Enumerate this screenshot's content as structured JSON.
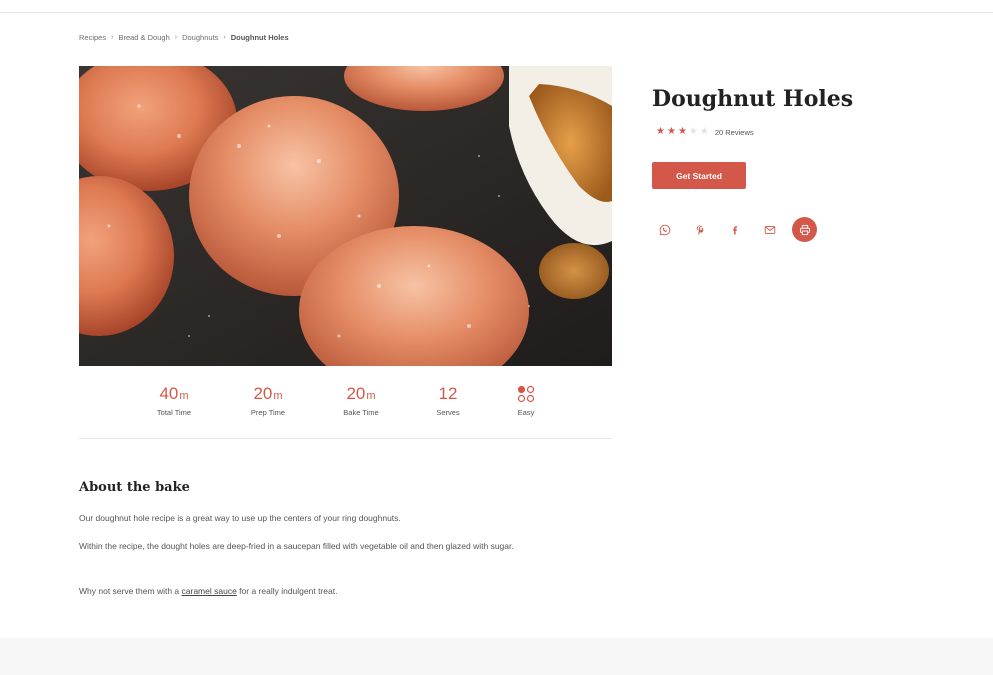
{
  "breadcrumb": {
    "items": [
      "Recipes",
      "Bread & Dough",
      "Doughnuts",
      "Doughnut Holes"
    ],
    "separator": "›"
  },
  "hero_image": {
    "alt": "Sugar coated doughnut holes with caramel sauce"
  },
  "stats": [
    {
      "value": "40",
      "unit": "m",
      "label": "Total Time"
    },
    {
      "value": "20",
      "unit": "m",
      "label": "Prep Time"
    },
    {
      "value": "20",
      "unit": "m",
      "label": "Bake Time"
    },
    {
      "value": "12",
      "unit": "",
      "label": "Serves"
    },
    {
      "value": "",
      "unit": "",
      "label": "Easy",
      "icon": "difficulty-dots-icon"
    }
  ],
  "about": {
    "heading": "About the bake",
    "p1": "Our doughnut hole recipe is a great way to use up the centers of your ring doughnuts.",
    "p2": "Within the recipe, the dought holes are deep-fried in a saucepan filled with vegetable oil and then glazed with sugar.",
    "p3_before": "Why not serve them with a ",
    "p3_link": "caramel sauce",
    "p3_after": " for a really indulgent treat."
  },
  "recipe": {
    "title": "Doughnut Holes",
    "rating_stars": 3,
    "rating_max": 5,
    "reviews": "20 Reviews",
    "cta": "Get Started"
  },
  "share_icons": [
    "whatsapp-icon",
    "pinterest-icon",
    "facebook-icon",
    "email-icon",
    "print-icon"
  ],
  "colors": {
    "accent": "#d4584a",
    "text": "#3a3a3a",
    "footer_bg": "#f6f7f6"
  }
}
